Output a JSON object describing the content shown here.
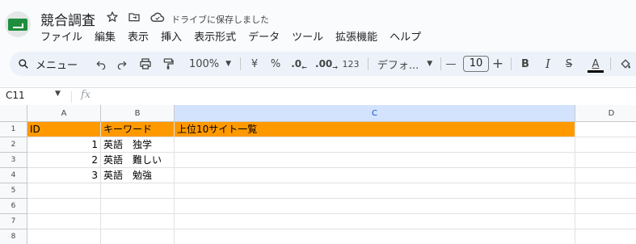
{
  "doc": {
    "title": "競合調査",
    "save_status": "ドライブに保存しました"
  },
  "menu": [
    "ファイル",
    "編集",
    "表示",
    "挿入",
    "表示形式",
    "データ",
    "ツール",
    "拡張機能",
    "ヘルプ"
  ],
  "toolbar": {
    "menu_search_label": "メニュー",
    "zoom": "100%",
    "currency": "¥",
    "percent": "%",
    "decimal_decrease": ".0",
    "decimal_increase": ".00",
    "number_format": "123",
    "font": "デフォ...",
    "font_size": "10",
    "minus": "—",
    "plus": "+",
    "bold": "B",
    "italic": "I",
    "strike": "S",
    "text_color": "A"
  },
  "formula_bar": {
    "cell_ref": "C11",
    "fx": "fx"
  },
  "sheet": {
    "columns": [
      "A",
      "B",
      "C",
      "D"
    ],
    "rows": [
      "1",
      "2",
      "3",
      "4",
      "5",
      "6",
      "7",
      "8"
    ],
    "header_fill": "#ff9900",
    "data": [
      [
        "ID",
        "キーワード",
        "上位10サイト一覧"
      ],
      [
        "1",
        "英語　独学",
        ""
      ],
      [
        "2",
        "英語　難しい",
        ""
      ],
      [
        "3",
        "英語　勉強",
        ""
      ]
    ]
  },
  "icons": {
    "star": "star-icon",
    "move": "move-to-folder-icon",
    "cloud": "cloud-saved-icon"
  }
}
